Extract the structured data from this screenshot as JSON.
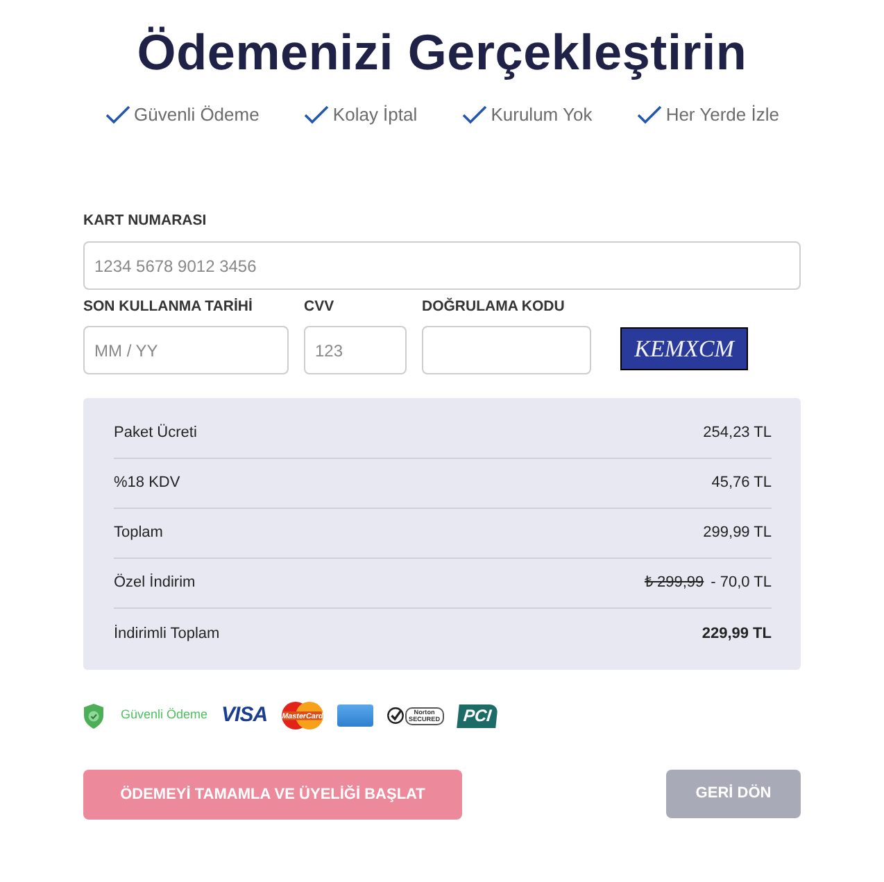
{
  "title": "Ödemenizi Gerçekleştirin",
  "features": [
    "Güvenli Ödeme",
    "Kolay İptal",
    "Kurulum Yok",
    "Her Yerde İzle"
  ],
  "form": {
    "card_number": {
      "label": "KART NUMARASI",
      "placeholder": "1234 5678 9012 3456"
    },
    "fields": [
      {
        "label": "SON KULLANMA TARİHİ",
        "placeholder": "MM / YY"
      },
      {
        "label": "CVV",
        "placeholder": "123"
      },
      {
        "label": "DOĞRULAMA KODU"
      }
    ],
    "captcha": {
      "text": "KEMXCM"
    }
  },
  "summary": {
    "rows": [
      {
        "label": "Paket Ücreti",
        "value": "254,23 TL",
        "bold_value": false
      },
      {
        "label": "%18 KDV",
        "value": "45,76 TL",
        "bold_value": false
      },
      {
        "label": "Toplam",
        "value": "299,99 TL",
        "bold_value": false
      },
      {
        "label": "Özel İndirim",
        "old_value": "₺ 299,99",
        "value": "- 70,0 TL",
        "bold_value": false
      },
      {
        "label": "İndirimli Toplam",
        "value": "229,99 TL",
        "bold_value": true
      }
    ]
  },
  "security_badges": [
    {
      "kind": "secure",
      "label": "Güvenli Ödeme"
    },
    {
      "kind": "visa",
      "label": "VISA"
    },
    {
      "kind": "mastercard",
      "label": "MasterCard"
    },
    {
      "kind": "amex"
    },
    {
      "kind": "norton",
      "label": "Norton",
      "sublabel": "SECURED"
    },
    {
      "kind": "pci",
      "label": "PCI"
    }
  ],
  "buttons": [
    {
      "label": "ÖDEMEYİ TAMAMLA VE ÜYELİĞİ BAŞLAT",
      "kind": "primary"
    },
    {
      "label": "GERİ DÖN",
      "kind": "secondary"
    }
  ]
}
